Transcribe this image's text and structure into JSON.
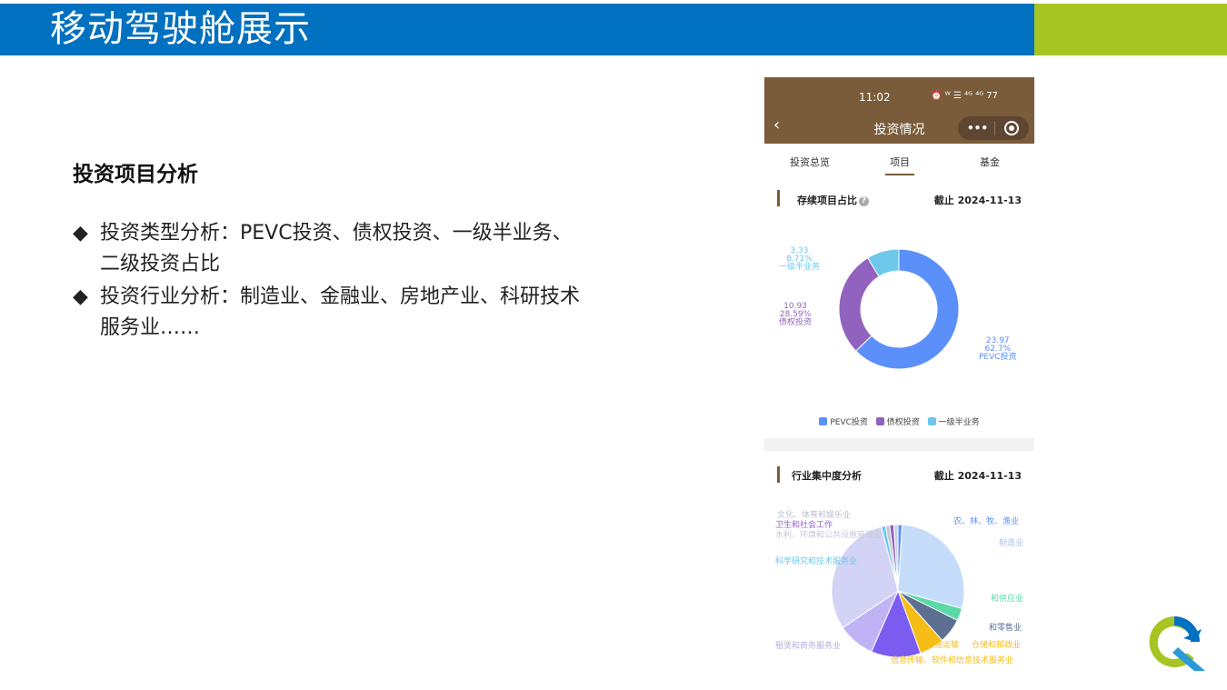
{
  "slide": {
    "title": "移动驾驶舱展示",
    "section_heading": "投资项目分析",
    "bullets": [
      {
        "mark": "◆",
        "text": "投资类型分析：PEVC投资、债权投资、一级半业务、二级投资占比"
      },
      {
        "mark": "◆",
        "text": "投资行业分析：制造业、金融业、房地产业、科研技术服务业……"
      }
    ],
    "colors": {
      "title_bar": "#0070c0",
      "accent_bar": "#a6c523"
    }
  },
  "phone": {
    "status_time": "11:02",
    "status_icons": "⏰ ᵂ ☰ ⁴ᴳ ⁴ᴳ 77",
    "back_icon": "chevron-left-icon",
    "page_title": "投资情况",
    "capsule": {
      "more": "•••",
      "close_icon": "target-icon"
    },
    "tabs": [
      {
        "label": "投资总览",
        "active": false
      },
      {
        "label": "项目",
        "active": true
      },
      {
        "label": "基金",
        "active": false
      }
    ],
    "section1": {
      "title": "存续项目占比",
      "help": "?",
      "date": "截止 2024-11-13"
    },
    "section2": {
      "title": "行业集中度分析",
      "date": "截止 2024-11-13"
    }
  },
  "chart_data": [
    {
      "type": "pie",
      "variant": "donut",
      "labels": [
        "PEVC投资",
        "债权投资",
        "一级半业务"
      ],
      "values": [
        23.97,
        10.93,
        3.33
      ],
      "percents": [
        "62.7%",
        "28.59%",
        "8.71%"
      ],
      "value_labels": [
        "23.97",
        "10.93",
        "3.33"
      ],
      "colors": [
        "#5b8ff9",
        "#9262bf",
        "#6dc8ec"
      ],
      "legend": [
        "PEVC投资",
        "债权投资",
        "一级半业务"
      ],
      "legend_position": "bottom"
    },
    {
      "type": "pie",
      "labels": [
        "农、林、牧、渔业",
        "制造业",
        "电力、热力、燃气及水生产和供应业",
        "批发和零售业",
        "交通运输、仓储和邮政业",
        "信息传输、软件和信息技术服务业",
        "金融业",
        "租赁和商务服务业",
        "科学研究和技术服务业",
        "水利、环境和公共设施管理业",
        "卫生和社会工作",
        "文化、体育和娱乐业"
      ],
      "visible_label_text": [
        "农、林、牧、渔业",
        "制造业",
        "和供应业",
        "和零售业",
        "交通运输",
        "仓储和邮政业",
        "信息传输、软件和信息技术服务业",
        "租赁和商务服务业",
        "科学研究和技术服务业",
        "水利、环境和公共设施管理业",
        "卫生和社会工作",
        "文化、体育和娱乐业"
      ],
      "values": [
        1,
        28,
        3,
        6,
        6,
        12,
        9,
        30,
        1,
        1,
        1,
        1
      ],
      "colors": [
        "#5b8ff9",
        "#c6dcfb",
        "#5ad8a6",
        "#5d7092",
        "#f6bd16",
        "#7b5cf0",
        "#bfb3f5",
        "#d3d3f5",
        "#6dc8ec",
        "#c0c8d8",
        "#9262bf",
        "#ccd2e0"
      ]
    }
  ]
}
